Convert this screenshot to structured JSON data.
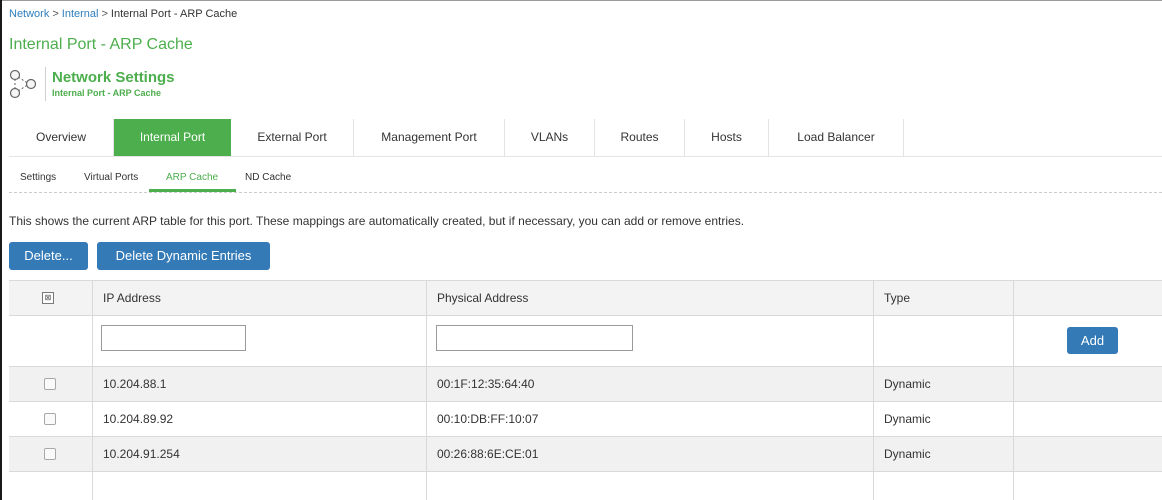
{
  "breadcrumb": {
    "items": [
      "Network",
      "Internal",
      "Internal Port - ARP Cache"
    ],
    "separator": ">"
  },
  "page_title": "Internal Port - ARP Cache",
  "section": {
    "title": "Network Settings",
    "subtitle": "Internal Port - ARP Cache",
    "icon": "network-icon"
  },
  "main_tabs": [
    {
      "label": "Overview"
    },
    {
      "label": "Internal Port"
    },
    {
      "label": "External Port"
    },
    {
      "label": "Management Port"
    },
    {
      "label": "VLANs"
    },
    {
      "label": "Routes"
    },
    {
      "label": "Hosts"
    },
    {
      "label": "Load Balancer"
    }
  ],
  "main_tabs_active": "Internal Port",
  "sub_tabs": [
    {
      "label": "Settings"
    },
    {
      "label": "Virtual Ports"
    },
    {
      "label": "ARP Cache"
    },
    {
      "label": "ND Cache"
    }
  ],
  "sub_tabs_active": "ARP Cache",
  "description": "This shows the current ARP table for this port. These mappings are automatically created, but if necessary, you can add or remove entries.",
  "buttons": {
    "delete": "Delete...",
    "delete_dynamic": "Delete Dynamic Entries",
    "add": "Add"
  },
  "table": {
    "headers": {
      "ip": "IP Address",
      "mac": "Physical Address",
      "type": "Type"
    },
    "new_entry": {
      "ip_value": "",
      "mac_value": ""
    },
    "rows": [
      {
        "ip": "10.204.88.1",
        "mac": "00:1F:12:35:64:40",
        "type": "Dynamic",
        "checked": false
      },
      {
        "ip": "10.204.89.92",
        "mac": "00:10:DB:FF:10:07",
        "type": "Dynamic",
        "checked": false
      },
      {
        "ip": "10.204.91.254",
        "mac": "00:26:88:6E:CE:01",
        "type": "Dynamic",
        "checked": false
      }
    ]
  },
  "colors": {
    "accent_green": "#4cae4c",
    "link_blue": "#2e7fbd",
    "button_blue": "#337ab7",
    "header_bg": "#f3f3f3",
    "stripe_bg": "#f1f1f1"
  }
}
